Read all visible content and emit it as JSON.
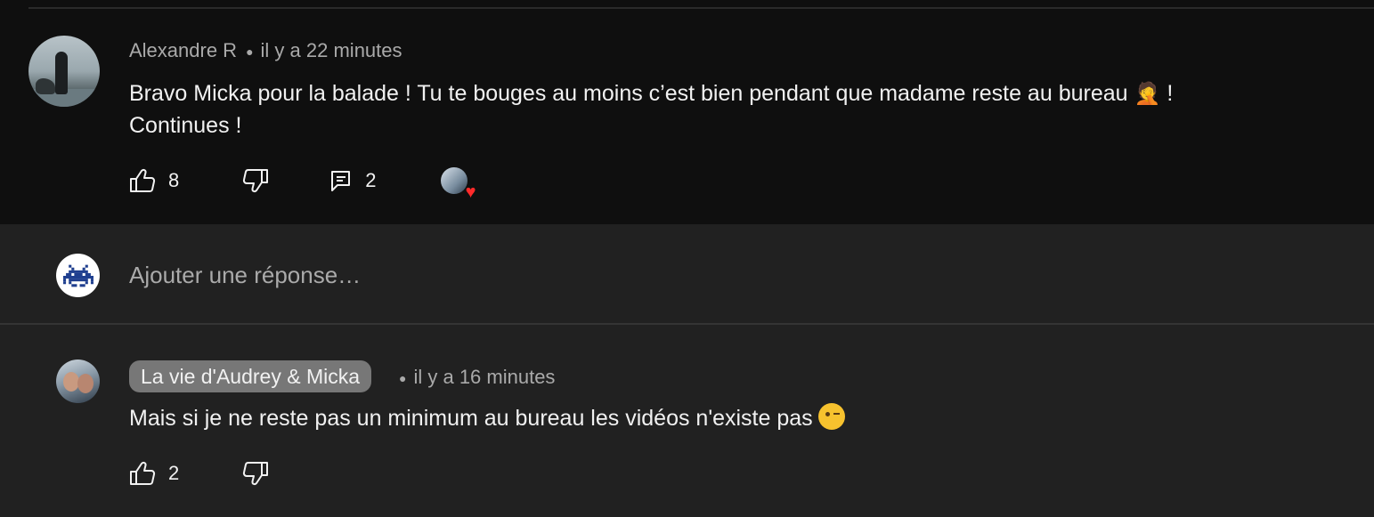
{
  "comment": {
    "author": "Alexandre R",
    "time": "il y a 22 minutes",
    "text_line1": "Bravo Micka pour la balade ! Tu te bouges au moins c’est bien pendant que madame reste au bureau",
    "emoji": "facepalm",
    "text_line1_end": "!",
    "text_line2": "Continues !",
    "like_count": "8",
    "reply_count": "2",
    "creator_heart": true
  },
  "reply_box": {
    "placeholder": "Ajouter une réponse…",
    "avatar_icon": "space-invader-icon"
  },
  "reply": {
    "author": "La vie d'Audrey & Micka",
    "time": "il y a 16 minutes",
    "text": "Mais si je ne reste pas un minimum au bureau les vidéos n'existe pas",
    "emoji": "winking-face",
    "like_count": "2"
  },
  "colors": {
    "background_comment": "#0f0f0f",
    "background_reply": "#212121",
    "badge": "#777777",
    "heart": "#ff2a2a",
    "secondary_text": "#aaaaaa"
  }
}
